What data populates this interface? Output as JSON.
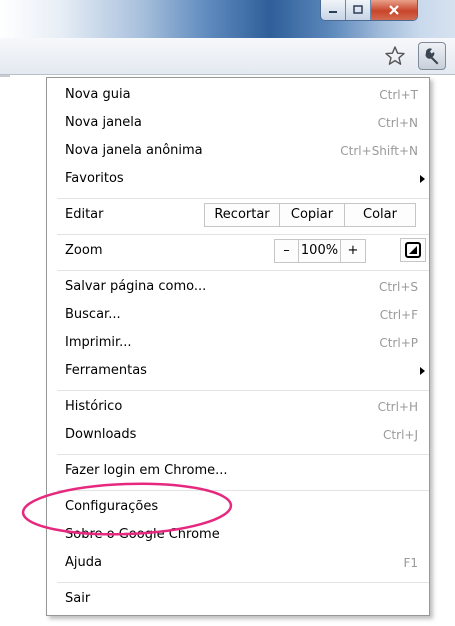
{
  "menu": {
    "new_tab": {
      "label": "Nova guia",
      "shortcut": "Ctrl+T"
    },
    "new_window": {
      "label": "Nova janela",
      "shortcut": "Ctrl+N"
    },
    "new_incognito": {
      "label": "Nova janela anônima",
      "shortcut": "Ctrl+Shift+N"
    },
    "bookmarks": {
      "label": "Favoritos"
    },
    "edit": {
      "label": "Editar",
      "cut": "Recortar",
      "copy": "Copiar",
      "paste": "Colar"
    },
    "zoom": {
      "label": "Zoom",
      "minus": "–",
      "level": "100%",
      "plus": "+"
    },
    "save_page": {
      "label": "Salvar página como...",
      "shortcut": "Ctrl+S"
    },
    "find": {
      "label": "Buscar...",
      "shortcut": "Ctrl+F"
    },
    "print": {
      "label": "Imprimir...",
      "shortcut": "Ctrl+P"
    },
    "tools": {
      "label": "Ferramentas"
    },
    "history": {
      "label": "Histórico",
      "shortcut": "Ctrl+H"
    },
    "downloads": {
      "label": "Downloads",
      "shortcut": "Ctrl+J"
    },
    "sign_in": {
      "label": "Fazer login em Chrome..."
    },
    "settings": {
      "label": "Configurações"
    },
    "about": {
      "label": "Sobre o Google Chrome"
    },
    "help": {
      "label": "Ajuda",
      "shortcut": "F1"
    },
    "exit": {
      "label": "Sair"
    }
  },
  "icons": [
    "minimize-icon",
    "maximize-icon",
    "close-icon",
    "star-icon",
    "wrench-icon",
    "fullscreen-icon"
  ],
  "colors": {
    "highlight_circle": "#e6287f",
    "shortcut_text": "#9a9a9a"
  }
}
